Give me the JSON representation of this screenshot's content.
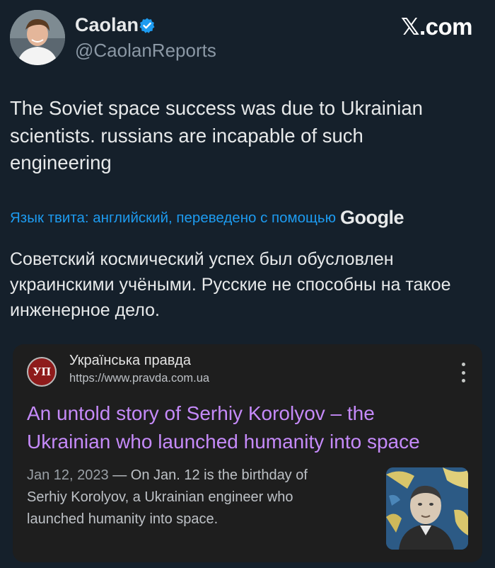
{
  "tweet": {
    "author": {
      "name": "Caolan",
      "handle": "@CaolanReports",
      "verified": true,
      "avatar": "avatar-photo"
    },
    "platform_mark": "𝕏.com",
    "text_lines": [
      "The Soviet space success was due to Ukrainian",
      "scientists. russians are incapable of such",
      "engineering"
    ],
    "translation_notice": "Язык твита: английский, переведено с помощью",
    "translation_provider": "Google",
    "translated_lines": [
      "Советский космический успех был обусловлен",
      "украинскими учёными. Русские не способны на такое",
      "инженерное дело."
    ]
  },
  "search_result": {
    "site_logo_text": "УП",
    "site_name": "Українська правда",
    "site_url": "https://www.pravda.com.ua",
    "title_lines": [
      "An untold story of Serhiy Korolyov – the",
      "Ukrainian who launched humanity into space"
    ],
    "date": "Jan 12, 2023",
    "snippet_lines": [
      "— On Jan. 12 is the birthday of",
      "Serhiy Korolyov, a Ukrainian engineer who",
      "launched humanity into space."
    ],
    "thumbnail": "portrait-photo"
  },
  "colors": {
    "background": "#15202b",
    "link_blue": "#1d9bf0",
    "card_bg": "#1e1e1e",
    "title_purple": "#c58af9"
  }
}
